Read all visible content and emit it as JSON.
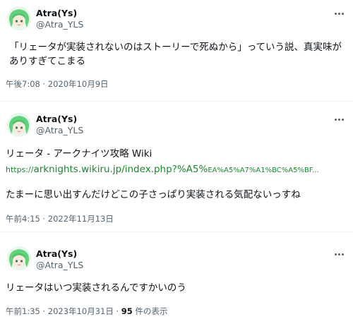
{
  "tweets": [
    {
      "display_name": "Atra(Ys)",
      "handle": "@Atra_YLS",
      "text": "「リェータが実装されないのはストーリーで死ぬから」っていう説、真実味がありすぎてこまる",
      "timestamp": "午後7:08 · 2020年10月9日"
    },
    {
      "display_name": "Atra(Ys)",
      "handle": "@Atra_YLS",
      "link_title": "リェータ - アークナイツ攻略 Wiki",
      "link_scheme": "https://",
      "link_domain_path": "arknights.wikiru.jp/index.php?%A5%",
      "link_encoded": "EA%A5%A7%A1%BC%A5%BF...",
      "text": "たまーに思い出すんだけどこの子さっぱり実装される気配ないっすね",
      "timestamp": "午前4:15 · 2022年11月13日"
    },
    {
      "display_name": "Atra(Ys)",
      "handle": "@Atra_YLS",
      "text": "リェータはいつ実装されるんですかいのう",
      "timestamp": "午前1:35 · 2023年10月31日 · ",
      "views_count": "95",
      "views_label": " 件の表示"
    }
  ],
  "colors": {
    "text": "#0f1419",
    "secondary": "#536471",
    "link": "#1a8a2e",
    "divider": "#eff3f4"
  },
  "icons": {
    "more": "more-options-icon",
    "avatar": "avatar"
  }
}
